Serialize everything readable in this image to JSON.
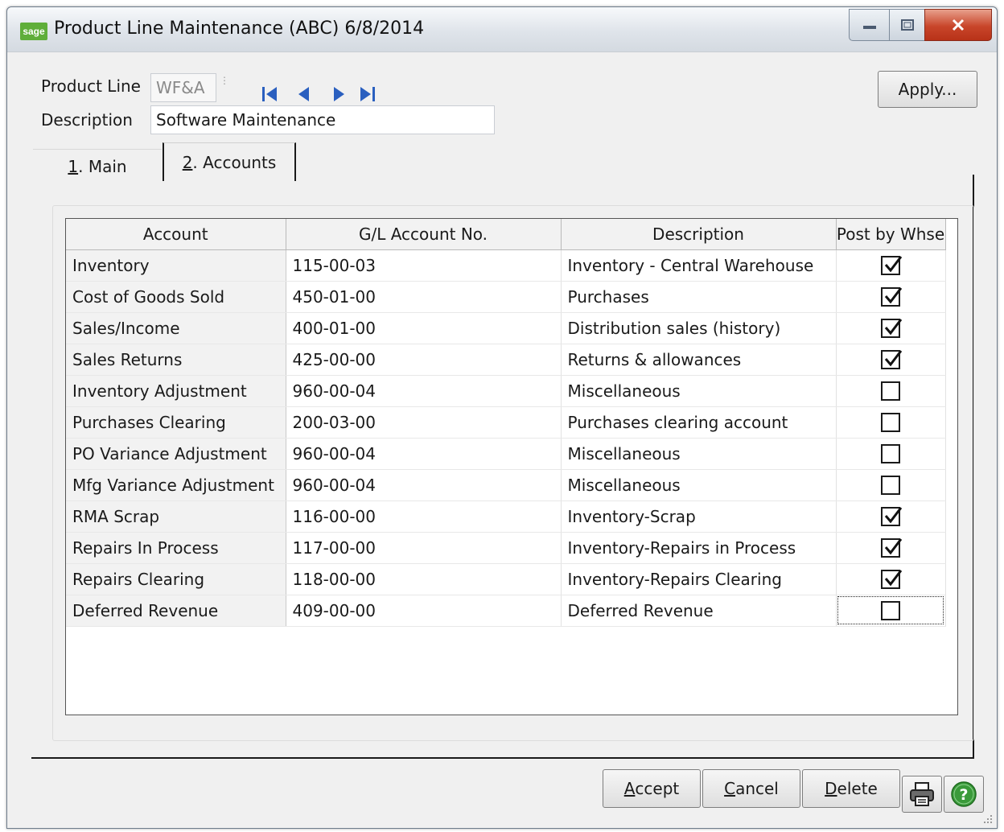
{
  "window": {
    "title": "Product Line Maintenance (ABC) 6/8/2014",
    "app_icon_text": "sage",
    "minimize_icon": "minimize-icon",
    "maximize_icon": "maximize-icon",
    "close_icon": "close-icon"
  },
  "header": {
    "product_line_label": "Product Line",
    "product_line_value": "WF&A",
    "description_label": "Description",
    "description_value": "Software Maintenance",
    "apply_label": "Apply...",
    "nav_icons": [
      "first-record-icon",
      "previous-record-icon",
      "next-record-icon",
      "last-record-icon"
    ]
  },
  "tabs": [
    {
      "key": "1",
      "label": ". Main",
      "active": false
    },
    {
      "key": "2",
      "label": ". Accounts",
      "active": true
    }
  ],
  "grid": {
    "columns": [
      "Account",
      "G/L Account No.",
      "Description",
      "Post by Whse"
    ],
    "rows": [
      {
        "account": "Inventory",
        "gl": "115-00-03",
        "desc": "Inventory - Central Warehouse",
        "post": true
      },
      {
        "account": "Cost of Goods Sold",
        "gl": "450-01-00",
        "desc": "Purchases",
        "post": true
      },
      {
        "account": "Sales/Income",
        "gl": "400-01-00",
        "desc": "Distribution sales (history)",
        "post": true
      },
      {
        "account": "Sales Returns",
        "gl": "425-00-00",
        "desc": "Returns & allowances",
        "post": true
      },
      {
        "account": "Inventory Adjustment",
        "gl": "960-00-04",
        "desc": "Miscellaneous",
        "post": false
      },
      {
        "account": "Purchases Clearing",
        "gl": "200-03-00",
        "desc": "Purchases clearing account",
        "post": false
      },
      {
        "account": "PO Variance Adjustment",
        "gl": "960-00-04",
        "desc": "Miscellaneous",
        "post": false
      },
      {
        "account": "Mfg Variance Adjustment",
        "gl": "960-00-04",
        "desc": "Miscellaneous",
        "post": false
      },
      {
        "account": "RMA Scrap",
        "gl": "116-00-00",
        "desc": "Inventory-Scrap",
        "post": true
      },
      {
        "account": "Repairs In Process",
        "gl": "117-00-00",
        "desc": "Inventory-Repairs in Process",
        "post": true
      },
      {
        "account": "Repairs Clearing",
        "gl": "118-00-00",
        "desc": "Inventory-Repairs Clearing",
        "post": true
      },
      {
        "account": "Deferred Revenue",
        "gl": "409-00-00",
        "desc": "Deferred Revenue",
        "post": false
      }
    ]
  },
  "footer": {
    "accept_key": "A",
    "accept_rest": "ccept",
    "cancel_key": "C",
    "cancel_rest": "ancel",
    "delete_key": "D",
    "delete_rest": "elete",
    "print_icon": "printer-icon",
    "help_icon": "help-icon"
  },
  "colors": {
    "help_green": "#3a9a3a",
    "nav_blue": "#2a5fbf",
    "sage_green": "#5fae3a"
  }
}
